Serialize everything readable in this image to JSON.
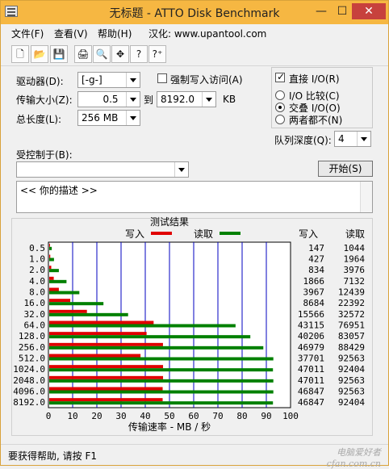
{
  "window": {
    "title": "无标题 - ATTO Disk Benchmark",
    "min": "—",
    "max": "☐",
    "close": "✕"
  },
  "menu": {
    "file": "文件(F)",
    "view": "查看(V)",
    "help": "帮助(H)",
    "credit": "汉化: www.upantool.com"
  },
  "toolbar": {
    "new_icon": "🗋",
    "open_icon": "📂",
    "save_icon": "💾",
    "print_icon": "🖨",
    "preview_icon": "🔍",
    "move_icon": "✥",
    "help_icon": "?",
    "context_help_icon": "?⁺"
  },
  "settings": {
    "drive_label": "驱动器(D):",
    "drive_value": "[-g-]",
    "force_write_label": "强制写入访问(A)",
    "direct_io_label": "直接 I/O(R)",
    "transfer_label": "传输大小(Z):",
    "transfer_min": "0.5",
    "to_label": "到",
    "transfer_max": "8192.0",
    "kb_label": "KB",
    "total_length_label": "总长度(L):",
    "total_length_value": "256 MB",
    "io_compare_label": "I/O 比较(C)",
    "overlap_io_label": "交叠 I/O(O)",
    "neither_label": "两者都不(N)",
    "queue_depth_label": "队列深度(Q):",
    "queue_depth_value": "4",
    "controlled_by_label": "受控制于(B):",
    "controlled_by_value": "",
    "start_button": "开始(S)",
    "description": "<<   你的描述   >>"
  },
  "status_bar": "要获得帮助, 请按 F1",
  "watermark": "电脑爱好者 cfan.com.cn",
  "colors": {
    "write": "#e00000",
    "read": "#008000",
    "grid": "#0000c0",
    "title_bar": "#f6b742",
    "close_button": "#c7413d"
  },
  "chart_data": {
    "type": "bar",
    "title": "测试结果",
    "legend": [
      {
        "label": "写入",
        "color": "#e00000"
      },
      {
        "label": "读取",
        "color": "#008000"
      }
    ],
    "column_headers": {
      "write": "写入",
      "read": "读取"
    },
    "xlabel": "传输速率 - MB / 秒",
    "xlim": [
      0,
      100
    ],
    "xticks": [
      "0",
      "10",
      "20",
      "30",
      "40",
      "50",
      "60",
      "70",
      "80",
      "90",
      "100"
    ],
    "categories": [
      "0.5",
      "1.0",
      "2.0",
      "4.0",
      "8.0",
      "16.0",
      "32.0",
      "64.0",
      "128.0",
      "256.0",
      "512.0",
      "1024.0",
      "2048.0",
      "4096.0",
      "8192.0"
    ],
    "series": [
      {
        "name": "写入",
        "values": [
          147,
          427,
          834,
          1866,
          3967,
          8684,
          15566,
          43115,
          40206,
          46979,
          37701,
          47011,
          47011,
          46847,
          46847
        ]
      },
      {
        "name": "读取",
        "values": [
          1044,
          1964,
          3976,
          7132,
          12439,
          22392,
          32572,
          76951,
          83057,
          88429,
          92563,
          92404,
          92563,
          92563,
          92404
        ]
      }
    ],
    "value_unit_note": "KB/s",
    "grid": true,
    "legend_position": "top"
  }
}
